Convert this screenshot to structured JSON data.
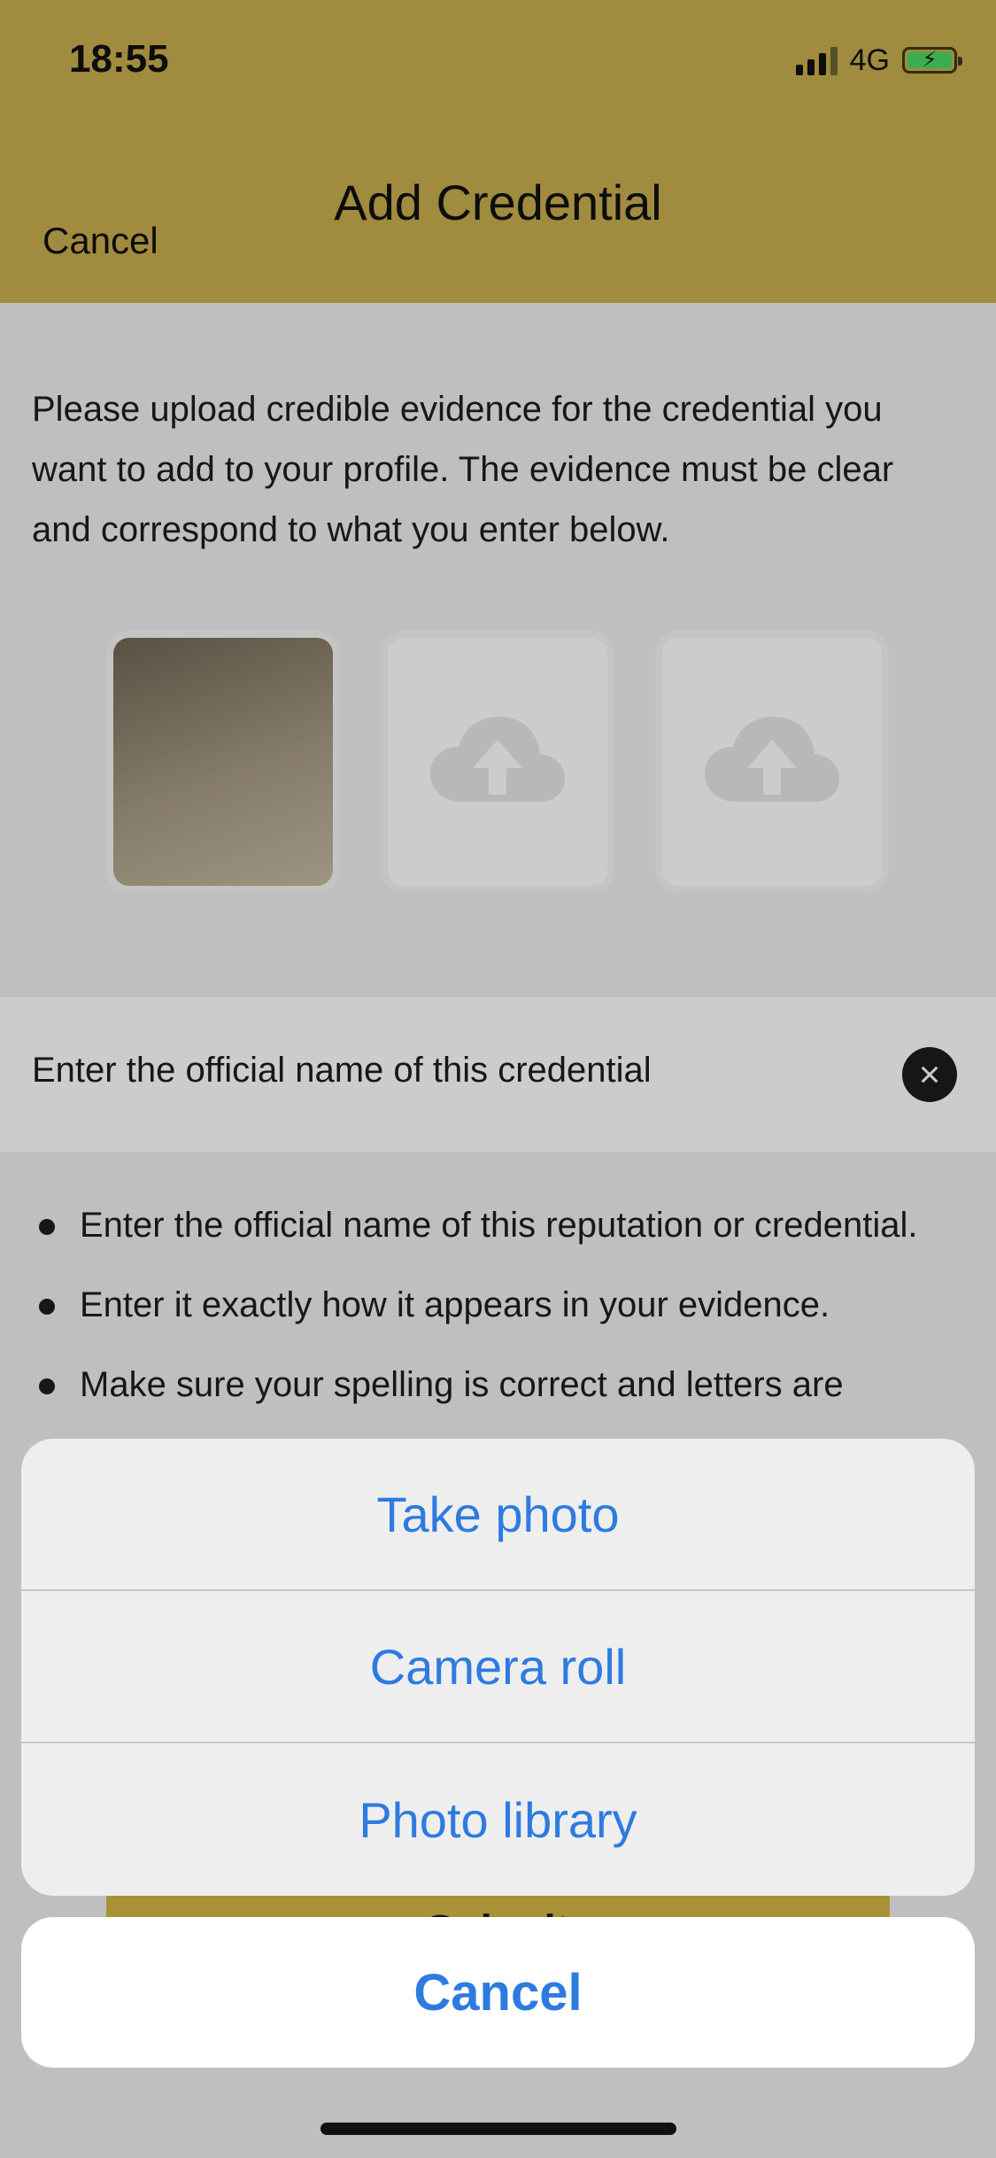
{
  "status_bar": {
    "time": "18:55",
    "network": "4G",
    "battery_charging": true
  },
  "nav": {
    "title": "Add Credential",
    "cancel_label": "Cancel"
  },
  "intro": "Please upload credible evidence for the credential you want to add to your profile. The evidence must be clear and correspond to what you enter below.",
  "uploads": [
    {
      "state": "filled",
      "icon": "photo-thumbnail"
    },
    {
      "state": "empty",
      "icon": "cloud-upload-icon"
    },
    {
      "state": "empty",
      "icon": "cloud-upload-icon"
    }
  ],
  "name_field": {
    "placeholder": "Enter the official name of this credential",
    "clear_icon": "clear-icon"
  },
  "tips": [
    "Enter the official name of this reputation or credential.",
    "Enter it exactly how it appears in your evidence.",
    "Make sure your spelling is correct and letters are"
  ],
  "submit_label": "Submit",
  "action_sheet": {
    "options": [
      "Take photo",
      "Camera roll",
      "Photo library"
    ],
    "cancel_label": "Cancel"
  },
  "colors": {
    "header": "#c9ae4e",
    "accent_button": "#d4b646",
    "action_text": "#2d7be0"
  }
}
